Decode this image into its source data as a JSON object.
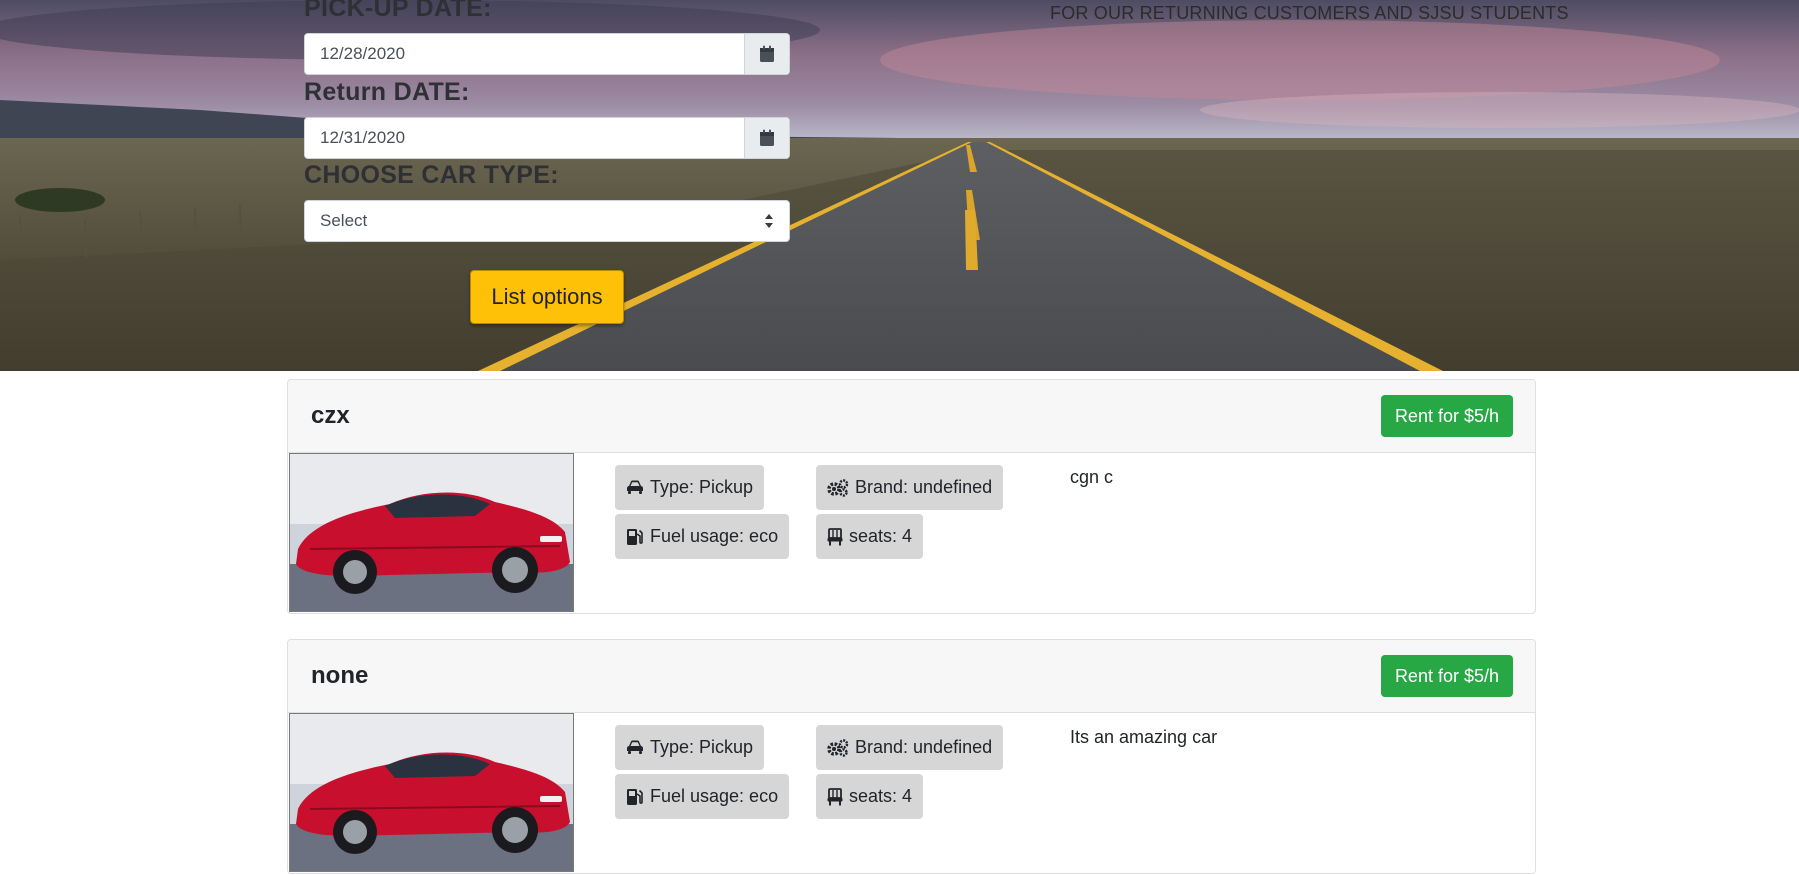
{
  "hero": {
    "promo_text": "FOR OUR RETURNING CUSTOMERS AND SJSU STUDENTS",
    "pickup_label": "PICK-UP DATE:",
    "pickup_value": "12/28/2020",
    "return_label": "Return DATE:",
    "return_value": "12/31/2020",
    "car_type_label": "CHOOSE CAR TYPE:",
    "car_type_selected": "Select",
    "list_button": "List options"
  },
  "colors": {
    "accent_yellow": "#ffc107",
    "rent_green": "#28a745",
    "badge_grey": "#d6d6d6"
  },
  "cars": [
    {
      "name": "czx",
      "rent_label": "Rent for $5/h",
      "type": "Type: Pickup",
      "brand": "Brand: undefined",
      "fuel": "Fuel usage: eco",
      "seats": "seats: 4",
      "description": "cgn c",
      "icons": [
        "car-icon",
        "gears-icon",
        "gas-pump-icon",
        "seat-icon"
      ]
    },
    {
      "name": "none",
      "rent_label": "Rent for $5/h",
      "type": "Type: Pickup",
      "brand": "Brand: undefined",
      "fuel": "Fuel usage: eco",
      "seats": "seats: 4",
      "description": "Its an amazing car",
      "icons": [
        "car-icon",
        "gears-icon",
        "gas-pump-icon",
        "seat-icon"
      ]
    }
  ]
}
